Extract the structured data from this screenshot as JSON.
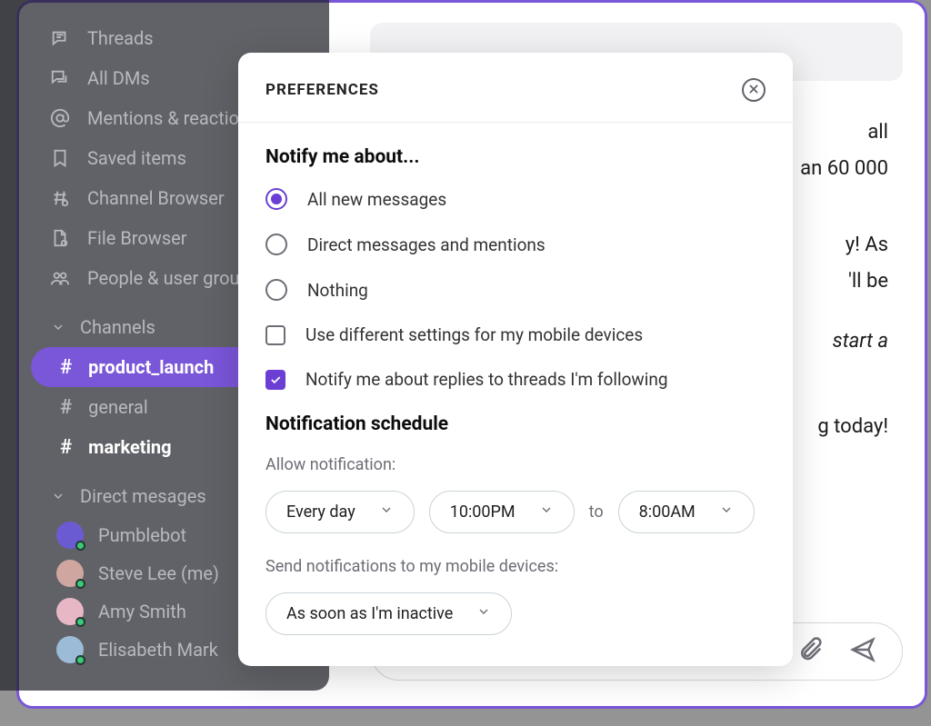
{
  "sidebar": {
    "nav": [
      {
        "icon": "threads-icon",
        "label": "Threads"
      },
      {
        "icon": "dm-icon",
        "label": "All DMs"
      },
      {
        "icon": "mention-icon",
        "label": "Mentions & reactions"
      },
      {
        "icon": "bookmark-icon",
        "label": "Saved items"
      },
      {
        "icon": "hash-browse-icon",
        "label": "Channel Browser"
      },
      {
        "icon": "file-icon",
        "label": "File Browser"
      },
      {
        "icon": "people-icon",
        "label": "People & user groups"
      }
    ],
    "channels_header": "Channels",
    "channels": [
      {
        "name": "product_launch",
        "active": true,
        "bold": true
      },
      {
        "name": "general",
        "active": false,
        "bold": false
      },
      {
        "name": "marketing",
        "active": false,
        "bold": true
      }
    ],
    "dm_header": "Direct mesages",
    "dms": [
      {
        "name": "Pumblebot",
        "color": "#6b5bd2"
      },
      {
        "name": "Steve Lee (me)",
        "color": "#cfa6a0"
      },
      {
        "name": "Amy Smith",
        "color": "#e8b7c6"
      },
      {
        "name": "Elisabeth Mark",
        "color": "#9bbbd6"
      }
    ]
  },
  "messages": {
    "line1_partial": "all",
    "line2_partial": "an 60 000",
    "line3_partial": "y! As",
    "line4_partial": "'ll be",
    "line5_italic": "start a",
    "line6_partial": "g today!"
  },
  "modal": {
    "title": "PREFERENCES",
    "notify_heading": "Notify me about...",
    "radio_options": [
      {
        "label": "All new messages",
        "selected": true
      },
      {
        "label": "Direct messages and mentions",
        "selected": false
      },
      {
        "label": "Nothing",
        "selected": false
      }
    ],
    "checkbox_options": [
      {
        "label": "Use different settings for my mobile devices",
        "checked": false
      },
      {
        "label": "Notify me about replies to threads I'm following",
        "checked": true
      }
    ],
    "schedule_heading": "Notification schedule",
    "allow_label": "Allow notification:",
    "schedule": {
      "days": "Every day",
      "from": "10:00PM",
      "to_word": "to",
      "to": "8:00AM"
    },
    "send_mobile_label": "Send notifications to my mobile devices:",
    "mobile_timing": "As soon as I'm inactive"
  }
}
